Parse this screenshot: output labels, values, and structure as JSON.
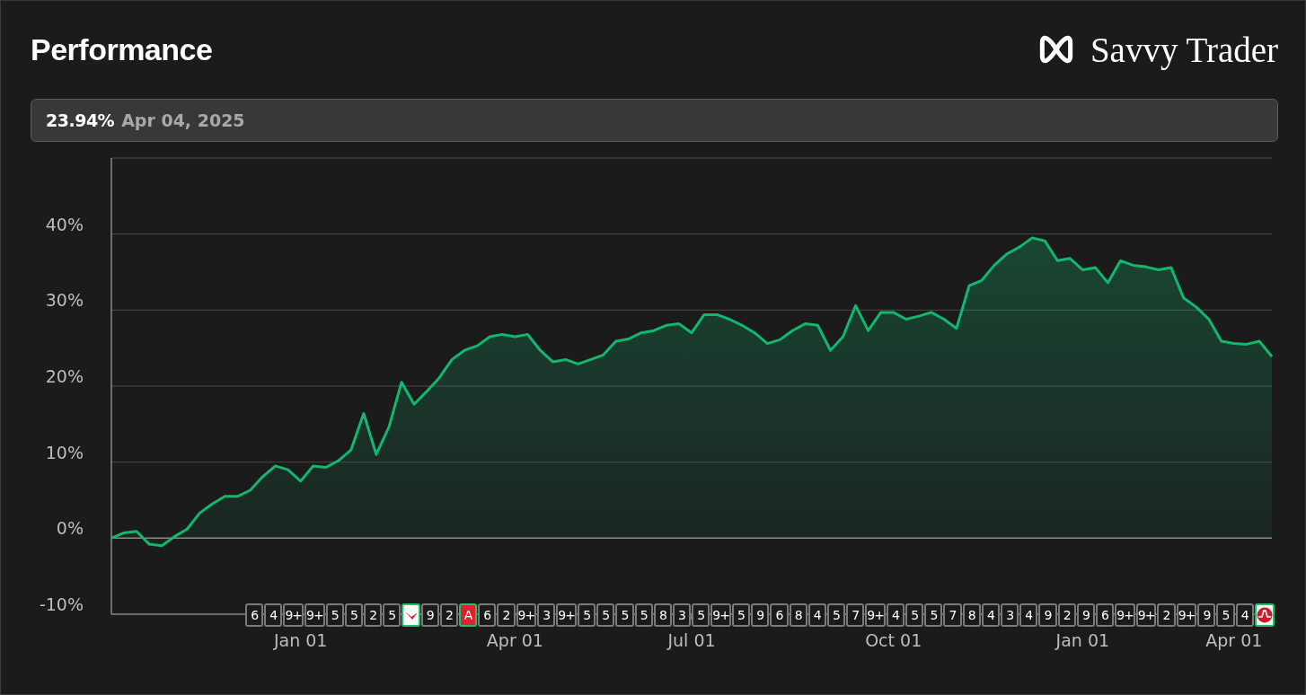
{
  "header": {
    "title": "Performance",
    "brand": "Savvy Trader"
  },
  "readout": {
    "value": "23.94%",
    "date": "Apr 04, 2025"
  },
  "chart": {
    "chart_data": {
      "type": "area",
      "grid": true,
      "categories": [
        null,
        null,
        null,
        null,
        null,
        null,
        null,
        null,
        null,
        null,
        null,
        null,
        null,
        null,
        null,
        "Jan 01",
        null,
        null,
        null,
        null,
        null,
        null,
        null,
        null,
        null,
        null,
        null,
        null,
        null,
        null,
        null,
        null,
        "Apr 01",
        null,
        null,
        null,
        null,
        null,
        null,
        null,
        null,
        null,
        null,
        null,
        null,
        null,
        "Jul 01",
        null,
        null,
        null,
        null,
        null,
        null,
        null,
        null,
        null,
        null,
        null,
        null,
        null,
        null,
        null,
        "Oct 01",
        null,
        null,
        null,
        null,
        null,
        null,
        null,
        null,
        null,
        null,
        null,
        null,
        null,
        null,
        "Jan 01",
        null,
        null,
        null,
        null,
        null,
        null,
        null,
        null,
        null,
        null,
        null,
        "Apr 01",
        null,
        null,
        null
      ],
      "series": [
        {
          "color": "#12b76f",
          "values": [
            0,
            0.7,
            0.9,
            -0.8,
            -1,
            0.2,
            1.2,
            3.3,
            4.5,
            5.5,
            5.5,
            6.3,
            8.1,
            9.5,
            9.0,
            7.5,
            9.5,
            9.3,
            10.2,
            11.6,
            16.4,
            11,
            14.6,
            20.5,
            17.6,
            19.3,
            21.1,
            23.5,
            24.7,
            25.3,
            26.5,
            26.8,
            26.5,
            26.8,
            24.7,
            23.2,
            23.5,
            22.9,
            23.5,
            24.1,
            25.9,
            26.2,
            27.0,
            27.3,
            28.0,
            28.2,
            27.0,
            29.4,
            29.4,
            28.8,
            28.0,
            27.0,
            25.6,
            26.1,
            27.3,
            28.2,
            28.0,
            24.7,
            26.5,
            30.6,
            27.3,
            29.7,
            29.7,
            28.8,
            29.2,
            29.7,
            28.8,
            27.6,
            33.2,
            33.9,
            35.9,
            37.4,
            38.3,
            39.5,
            39.1,
            36.5,
            36.8,
            35.3,
            35.6,
            33.6,
            36.5,
            35.9,
            35.7,
            35.3,
            35.6,
            31.6,
            30.4,
            28.8,
            25.9,
            25.6,
            25.5,
            25.9,
            23.9
          ]
        }
      ],
      "ylim": [
        -10,
        50
      ],
      "yticks": [
        {
          "value": -10,
          "label": "-10%"
        },
        {
          "value": 0,
          "label": "0%"
        },
        {
          "value": 10,
          "label": "10%"
        },
        {
          "value": 20,
          "label": "20%"
        },
        {
          "value": 30,
          "label": "30%"
        },
        {
          "value": 40,
          "label": "40%"
        }
      ]
    },
    "markers": [
      {
        "kind": "count",
        "text": "6",
        "highlighted": false
      },
      {
        "kind": "count",
        "text": "4",
        "highlighted": false
      },
      {
        "kind": "count",
        "text": "9+",
        "highlighted": false
      },
      {
        "kind": "count",
        "text": "9+",
        "highlighted": false
      },
      {
        "kind": "count",
        "text": "5",
        "highlighted": false
      },
      {
        "kind": "count",
        "text": "5",
        "highlighted": false
      },
      {
        "kind": "count",
        "text": "2",
        "highlighted": false
      },
      {
        "kind": "count",
        "text": "5",
        "highlighted": false
      },
      {
        "kind": "swoosh",
        "highlighted": true
      },
      {
        "kind": "count",
        "text": "9",
        "highlighted": false
      },
      {
        "kind": "count",
        "text": "2",
        "highlighted": false
      },
      {
        "kind": "letter",
        "text": "A",
        "highlighted": true
      },
      {
        "kind": "count",
        "text": "6",
        "highlighted": false
      },
      {
        "kind": "count",
        "text": "2",
        "highlighted": false
      },
      {
        "kind": "count",
        "text": "9+",
        "highlighted": false
      },
      {
        "kind": "count",
        "text": "3",
        "highlighted": false
      },
      {
        "kind": "count",
        "text": "9+",
        "highlighted": false
      },
      {
        "kind": "count",
        "text": "5",
        "highlighted": false
      },
      {
        "kind": "count",
        "text": "5",
        "highlighted": false
      },
      {
        "kind": "count",
        "text": "5",
        "highlighted": false
      },
      {
        "kind": "count",
        "text": "5",
        "highlighted": false
      },
      {
        "kind": "count",
        "text": "8",
        "highlighted": false
      },
      {
        "kind": "count",
        "text": "3",
        "highlighted": false
      },
      {
        "kind": "count",
        "text": "5",
        "highlighted": false
      },
      {
        "kind": "count",
        "text": "9+",
        "highlighted": false
      },
      {
        "kind": "count",
        "text": "5",
        "highlighted": false
      },
      {
        "kind": "count",
        "text": "9",
        "highlighted": false
      },
      {
        "kind": "count",
        "text": "6",
        "highlighted": false
      },
      {
        "kind": "count",
        "text": "8",
        "highlighted": false
      },
      {
        "kind": "count",
        "text": "4",
        "highlighted": false
      },
      {
        "kind": "count",
        "text": "5",
        "highlighted": false
      },
      {
        "kind": "count",
        "text": "7",
        "highlighted": false
      },
      {
        "kind": "count",
        "text": "9+",
        "highlighted": false
      },
      {
        "kind": "count",
        "text": "4",
        "highlighted": false
      },
      {
        "kind": "count",
        "text": "5",
        "highlighted": false
      },
      {
        "kind": "count",
        "text": "5",
        "highlighted": false
      },
      {
        "kind": "count",
        "text": "7",
        "highlighted": false
      },
      {
        "kind": "count",
        "text": "8",
        "highlighted": false
      },
      {
        "kind": "count",
        "text": "4",
        "highlighted": false
      },
      {
        "kind": "count",
        "text": "3",
        "highlighted": false
      },
      {
        "kind": "count",
        "text": "4",
        "highlighted": false
      },
      {
        "kind": "count",
        "text": "9",
        "highlighted": false
      },
      {
        "kind": "count",
        "text": "2",
        "highlighted": false
      },
      {
        "kind": "count",
        "text": "9",
        "highlighted": false
      },
      {
        "kind": "count",
        "text": "6",
        "highlighted": false
      },
      {
        "kind": "count",
        "text": "9+",
        "highlighted": false
      },
      {
        "kind": "count",
        "text": "9+",
        "highlighted": false
      },
      {
        "kind": "count",
        "text": "2",
        "highlighted": false
      },
      {
        "kind": "count",
        "text": "9+",
        "highlighted": false
      },
      {
        "kind": "count",
        "text": "9",
        "highlighted": false
      },
      {
        "kind": "count",
        "text": "5",
        "highlighted": false
      },
      {
        "kind": "count",
        "text": "4",
        "highlighted": false
      },
      {
        "kind": "pulse",
        "highlighted": true
      }
    ]
  }
}
